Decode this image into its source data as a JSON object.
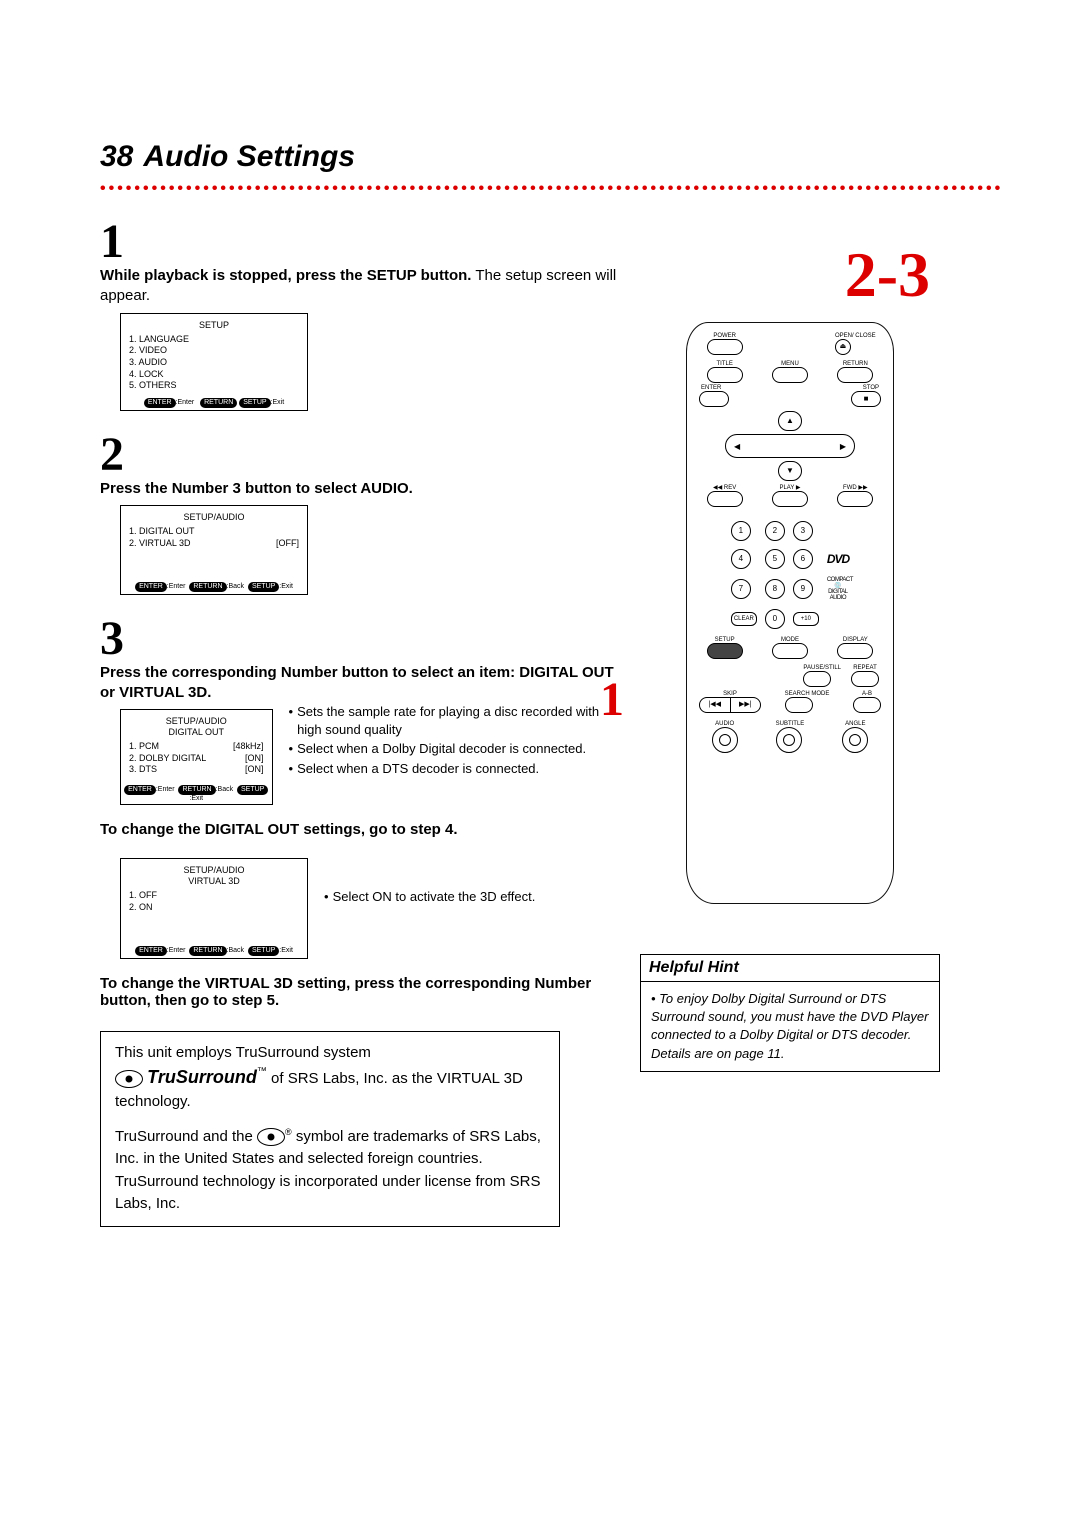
{
  "page_number": "38",
  "page_title": "Audio Settings",
  "step_nums": {
    "s1": "1",
    "s2": "2",
    "s3": "3",
    "big23": "2-3",
    "marker1": "1"
  },
  "step1": {
    "bold": "While playback is stopped, press the SETUP button.",
    "rest": " The setup screen will appear."
  },
  "osd1": {
    "title": "SETUP",
    "items": [
      "1. LANGUAGE",
      "2. VIDEO",
      "3. AUDIO",
      "4. LOCK",
      "5. OTHERS"
    ]
  },
  "footer1": {
    "a": "ENTER",
    "at": ":Enter",
    "b": "RETURN",
    "c": "SETUP",
    "ct": ":Exit"
  },
  "step2_bold": "Press the Number 3 button to select AUDIO.",
  "osd2": {
    "title": "SETUP/AUDIO",
    "rows": [
      {
        "l": "1. DIGITAL OUT",
        "r": ""
      },
      {
        "l": "2. VIRTUAL 3D",
        "r": "[OFF]"
      }
    ]
  },
  "footer2": {
    "a": "ENTER",
    "at": ":Enter",
    "b": "RETURN",
    "bt": ":Back",
    "c": "SETUP",
    "ct": ":Exit"
  },
  "step3_bold": "Press the corresponding Number button to select an item: DIGITAL OUT or VIRTUAL 3D.",
  "osd3": {
    "title": "SETUP/AUDIO",
    "sub": "DIGITAL OUT",
    "rows": [
      {
        "l": "1. PCM",
        "r": "[48kHz]"
      },
      {
        "l": "2. DOLBY DIGITAL",
        "r": "[ON]"
      },
      {
        "l": "3. DTS",
        "r": "[ON]"
      }
    ]
  },
  "bullets3": [
    "Sets the sample rate for playing a disc recorded with high sound quality",
    "Select when a Dolby Digital decoder is connected.",
    "Select when a DTS decoder is connected."
  ],
  "note_digital": "To change the DIGITAL OUT settings, go to step 4.",
  "osd4": {
    "title": "SETUP/AUDIO",
    "sub": "VIRTUAL 3D",
    "rows": [
      {
        "l": "1. OFF",
        "r": ""
      },
      {
        "l": "2. ON",
        "r": ""
      }
    ]
  },
  "bullet4": "Select ON to activate the 3D effect.",
  "note_virtual": "To change the VIRTUAL 3D setting, press the corresponding Number button, then go to step 5.",
  "tru": {
    "l1a": "This unit employs TruSurround system",
    "logo": "TruSurround",
    "tm": "™",
    "l1b": " of SRS Labs, Inc. as the VIRTUAL 3D technology.",
    "l2a": "TruSurround and the ",
    "reg": "®",
    "l2b": " symbol are trademarks of SRS Labs, Inc. in the United States and selected foreign countries.",
    "l3": "TruSurround technology is incorporated under license from SRS Labs, Inc."
  },
  "hint": {
    "title": "Helpful Hint",
    "body": "To enjoy Dolby Digital Surround or DTS Surround sound, you must have the DVD Player connected to a Dolby Digital or DTS decoder. Details are on page 11."
  },
  "remote": {
    "power": "POWER",
    "open": "OPEN/\nCLOSE",
    "title": "TITLE",
    "menu": "MENU",
    "return": "RETURN",
    "enter": "ENTER",
    "stop": "STOP",
    "rev": "◀◀ REV",
    "play": "PLAY ▶",
    "fwd": "FWD ▶▶",
    "nums": [
      "1",
      "2",
      "3",
      "4",
      "5",
      "6",
      "7",
      "8",
      "9"
    ],
    "clear": "CLEAR",
    "zero": "0",
    "plus10": "+10",
    "setup": "SETUP",
    "mode": "MODE",
    "display": "DISPLAY",
    "pause": "PAUSE/STILL",
    "repeat": "REPEAT",
    "skip": "SKIP",
    "search": "SEARCH MODE",
    "ab": "A-B",
    "prev": "|◀◀",
    "next": "▶▶|",
    "audio": "AUDIO",
    "subtitle": "SUBTITLE",
    "angle": "ANGLE",
    "dvd": "DVD",
    "compact": "COMPACT",
    "disc1": "DIGITAL AUDIO",
    "stopicon": "■",
    "ejecticon": "⏏",
    "up": "▲",
    "down": "▼",
    "left": "◀",
    "right": "▶"
  }
}
